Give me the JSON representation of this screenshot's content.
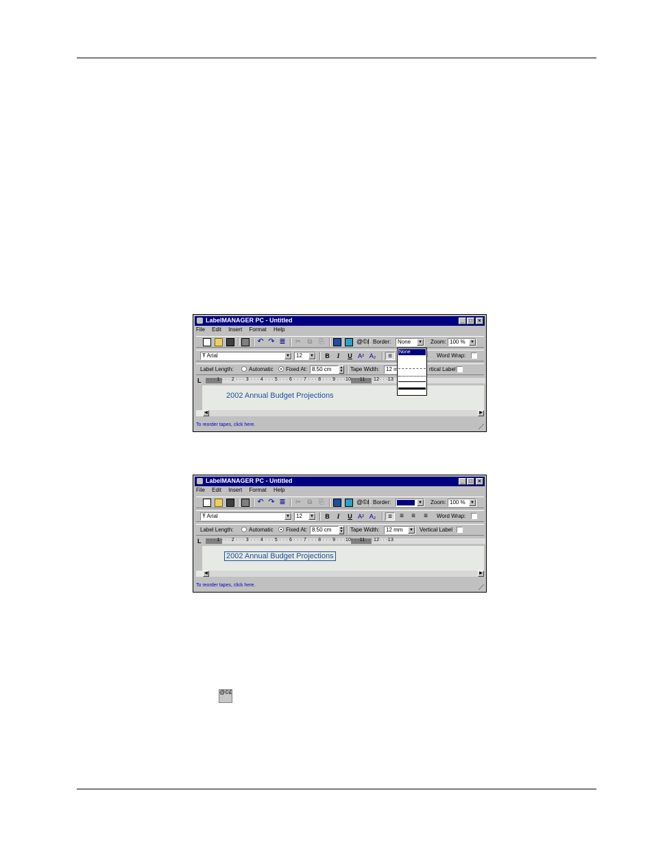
{
  "windows": [
    {
      "title": "LabelMANAGER PC - Untitled",
      "menu": [
        "File",
        "Edit",
        "Insert",
        "Format",
        "Help"
      ],
      "border_label": "Border:",
      "border_value": "None",
      "zoom_label": "Zoom:",
      "zoom_value": "100 %",
      "font_name": "Arial",
      "font_size": "12",
      "word_wrap_label": "Word Wrap:",
      "label_length_label": "Label Length:",
      "automatic_label": "Automatic",
      "fixed_at_label": "Fixed At:",
      "fixed_at_value": "8.50 cm",
      "tape_width_label": "Tape Width:",
      "tape_width_value": "12 mm",
      "vertical_label": "Vertical Label",
      "vertical_label_partial": "rtical Label",
      "tape_width_partial": "12 m",
      "ruler_ticks": "· · · 1 · · · 2 · · · 3 · · · 4 · · · 5 · · · 6 · · · 7 · · · 8 · · · 9 · · ·10· · ·11· · ·12· · ·13",
      "label_text": "2002 Annual Budget Projections",
      "status_text": "To reorder tapes, click here.",
      "border_dropdown_open": true,
      "border_options": [
        "None"
      ]
    },
    {
      "title": "LabelMANAGER PC - Untitled",
      "menu": [
        "File",
        "Edit",
        "Insert",
        "Format",
        "Help"
      ],
      "border_label": "Border:",
      "zoom_label": "Zoom:",
      "zoom_value": "100 %",
      "font_name": "Arial",
      "font_size": "12",
      "word_wrap_label": "Word Wrap:",
      "label_length_label": "Label Length:",
      "automatic_label": "Automatic",
      "fixed_at_label": "Fixed At:",
      "fixed_at_value": "8.50 cm",
      "tape_width_label": "Tape Width:",
      "tape_width_value": "12 mm",
      "vertical_label": "Vertical Label",
      "ruler_ticks": "· · · 1 · · · 2 · · · 3 · · · 4 · · · 5 · · · 6 · · · 7 · · · 8 · · · 9 · · ·10· · ·11· · ·12· · ·13",
      "label_text": "2002 Annual Budget Projections",
      "status_text": "To reorder tapes, click here.",
      "border_dropdown_open": false
    }
  ],
  "icons": {
    "app": "labelmanager-app-icon",
    "insert_symbol": "insert-symbol-icon",
    "symbol_glyph": "@©£"
  },
  "colors": {
    "titlebar": "#000080",
    "label_text": "#1f4fa0",
    "status_link": "#0000cc"
  }
}
